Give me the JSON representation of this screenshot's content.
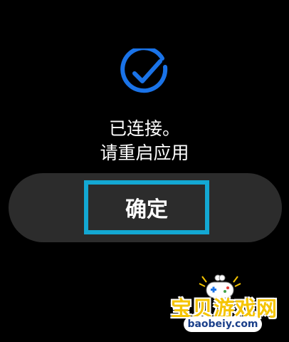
{
  "dialog": {
    "line1": "已连接。",
    "line2": "请重启应用",
    "confirm_label": "确定"
  },
  "watermark": {
    "title": "宝贝游戏网",
    "url": "baobeiy.com"
  },
  "colors": {
    "background": "#000000",
    "check_accent": "#1a73e8",
    "focus_border": "#13a8d3",
    "pill": "#2c2c2c",
    "text": "#ffffff"
  },
  "icons": {
    "status": "check-circle-icon"
  }
}
